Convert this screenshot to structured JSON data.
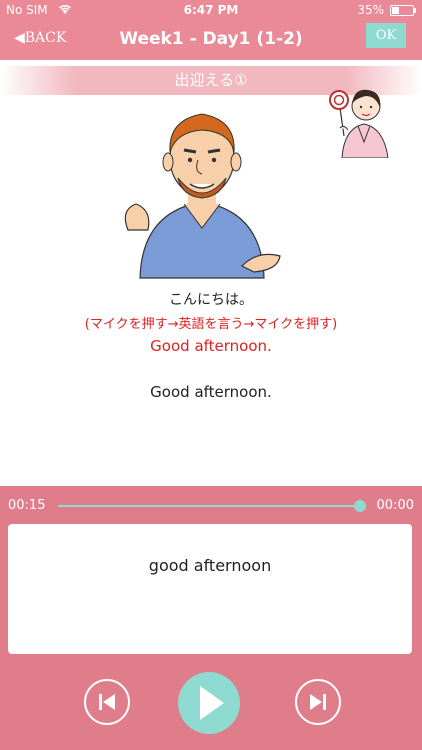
{
  "status_bar": {
    "carrier": "No SIM",
    "wifi_icon": "wifi-icon",
    "time": "6:47 PM",
    "battery": "35%"
  },
  "nav": {
    "back_label": "◀BACK",
    "title": "Week1 - Day1 (1-2)",
    "ok_label": "OK"
  },
  "section": {
    "title": "出迎える①"
  },
  "lesson": {
    "japanese": "こんにちは。",
    "instruction": "(マイクを押す→英語を言う→マイクを押す)",
    "english_target": "Good afternoon.",
    "english_model": "Good afternoon."
  },
  "player": {
    "time_elapsed": "00:15",
    "time_remaining": "00:00",
    "progress": 1.0,
    "recognized_text": "good afternoon",
    "accent_color": "#8fdad0",
    "panel_color": "#df7d8b"
  },
  "icons": {
    "prev": "skip-previous-icon",
    "play": "play-icon",
    "next": "skip-next-icon"
  }
}
